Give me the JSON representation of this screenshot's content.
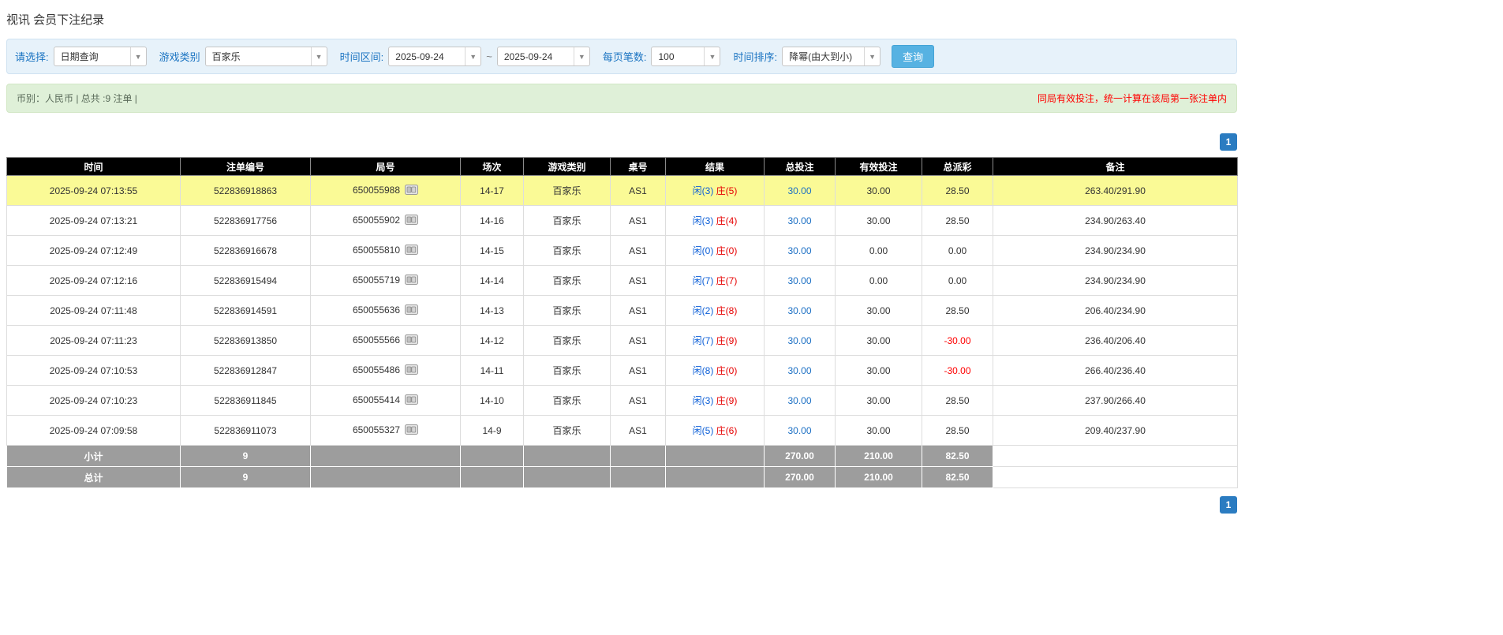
{
  "page": {
    "title": "视讯 会员下注纪录"
  },
  "filters": {
    "query_type_label": "请选择:",
    "query_type_value": "日期查询",
    "game_type_label": "游戏类别",
    "game_type_value": "百家乐",
    "time_range_label": "时间区间:",
    "date_from": "2025-09-24",
    "range_separator": "~",
    "date_to": "2025-09-24",
    "page_size_label": "每页笔数:",
    "page_size_value": "100",
    "sort_label": "时间排序:",
    "sort_value": "降幂(由大到小)",
    "search_button_label": "查询"
  },
  "summary": {
    "left_text": "币别：人民币 | 总共 :9 注单 |",
    "right_text": "同局有效投注，统一计算在该局第一张注单内"
  },
  "pagination": {
    "current_page": "1"
  },
  "table": {
    "headers": [
      "时间",
      "注单编号",
      "局号",
      "场次",
      "游戏类别",
      "桌号",
      "结果",
      "总投注",
      "有效投注",
      "总派彩",
      "备注"
    ],
    "rows": [
      {
        "time": "2025-09-24 07:13:55",
        "bet_id": "522836918863",
        "round": "650055988",
        "session": "14-17",
        "game": "百家乐",
        "table_no": "AS1",
        "result_player": "闲(3)",
        "result_banker": "庄(5)",
        "total_bet": "30.00",
        "valid_bet": "30.00",
        "payout": "28.50",
        "payout_negative": false,
        "note": "263.40/291.90",
        "highlight": true
      },
      {
        "time": "2025-09-24 07:13:21",
        "bet_id": "522836917756",
        "round": "650055902",
        "session": "14-16",
        "game": "百家乐",
        "table_no": "AS1",
        "result_player": "闲(3)",
        "result_banker": "庄(4)",
        "total_bet": "30.00",
        "valid_bet": "30.00",
        "payout": "28.50",
        "payout_negative": false,
        "note": "234.90/263.40",
        "highlight": false
      },
      {
        "time": "2025-09-24 07:12:49",
        "bet_id": "522836916678",
        "round": "650055810",
        "session": "14-15",
        "game": "百家乐",
        "table_no": "AS1",
        "result_player": "闲(0)",
        "result_banker": "庄(0)",
        "total_bet": "30.00",
        "valid_bet": "0.00",
        "payout": "0.00",
        "payout_negative": false,
        "note": "234.90/234.90",
        "highlight": false
      },
      {
        "time": "2025-09-24 07:12:16",
        "bet_id": "522836915494",
        "round": "650055719",
        "session": "14-14",
        "game": "百家乐",
        "table_no": "AS1",
        "result_player": "闲(7)",
        "result_banker": "庄(7)",
        "total_bet": "30.00",
        "valid_bet": "0.00",
        "payout": "0.00",
        "payout_negative": false,
        "note": "234.90/234.90",
        "highlight": false
      },
      {
        "time": "2025-09-24 07:11:48",
        "bet_id": "522836914591",
        "round": "650055636",
        "session": "14-13",
        "game": "百家乐",
        "table_no": "AS1",
        "result_player": "闲(2)",
        "result_banker": "庄(8)",
        "total_bet": "30.00",
        "valid_bet": "30.00",
        "payout": "28.50",
        "payout_negative": false,
        "note": "206.40/234.90",
        "highlight": false
      },
      {
        "time": "2025-09-24 07:11:23",
        "bet_id": "522836913850",
        "round": "650055566",
        "session": "14-12",
        "game": "百家乐",
        "table_no": "AS1",
        "result_player": "闲(7)",
        "result_banker": "庄(9)",
        "total_bet": "30.00",
        "valid_bet": "30.00",
        "payout": "-30.00",
        "payout_negative": true,
        "note": "236.40/206.40",
        "highlight": false
      },
      {
        "time": "2025-09-24 07:10:53",
        "bet_id": "522836912847",
        "round": "650055486",
        "session": "14-11",
        "game": "百家乐",
        "table_no": "AS1",
        "result_player": "闲(8)",
        "result_banker": "庄(0)",
        "total_bet": "30.00",
        "valid_bet": "30.00",
        "payout": "-30.00",
        "payout_negative": true,
        "note": "266.40/236.40",
        "highlight": false
      },
      {
        "time": "2025-09-24 07:10:23",
        "bet_id": "522836911845",
        "round": "650055414",
        "session": "14-10",
        "game": "百家乐",
        "table_no": "AS1",
        "result_player": "闲(3)",
        "result_banker": "庄(9)",
        "total_bet": "30.00",
        "valid_bet": "30.00",
        "payout": "28.50",
        "payout_negative": false,
        "note": "237.90/266.40",
        "highlight": false
      },
      {
        "time": "2025-09-24 07:09:58",
        "bet_id": "522836911073",
        "round": "650055327",
        "session": "14-9",
        "game": "百家乐",
        "table_no": "AS1",
        "result_player": "闲(5)",
        "result_banker": "庄(6)",
        "total_bet": "30.00",
        "valid_bet": "30.00",
        "payout": "28.50",
        "payout_negative": false,
        "note": "209.40/237.90",
        "highlight": false
      }
    ],
    "subtotal": {
      "label": "小计",
      "count": "9",
      "total_bet": "270.00",
      "valid_bet": "210.00",
      "payout": "82.50"
    },
    "grand_total": {
      "label": "总计",
      "count": "9",
      "total_bet": "270.00",
      "valid_bet": "210.00",
      "payout": "82.50"
    }
  },
  "colors": {
    "accent_button": "#57b2e2",
    "link_blue": "#1b6fc4",
    "player_blue": "#0b5ed7",
    "banker_red": "#e60000",
    "negative_red": "#ff0000",
    "highlight_yellow": "#fafa96",
    "header_black": "#000000",
    "footer_gray": "#9d9d9d",
    "summary_green": "#dff0d8",
    "filter_blue_bg": "#e7f2fa"
  }
}
